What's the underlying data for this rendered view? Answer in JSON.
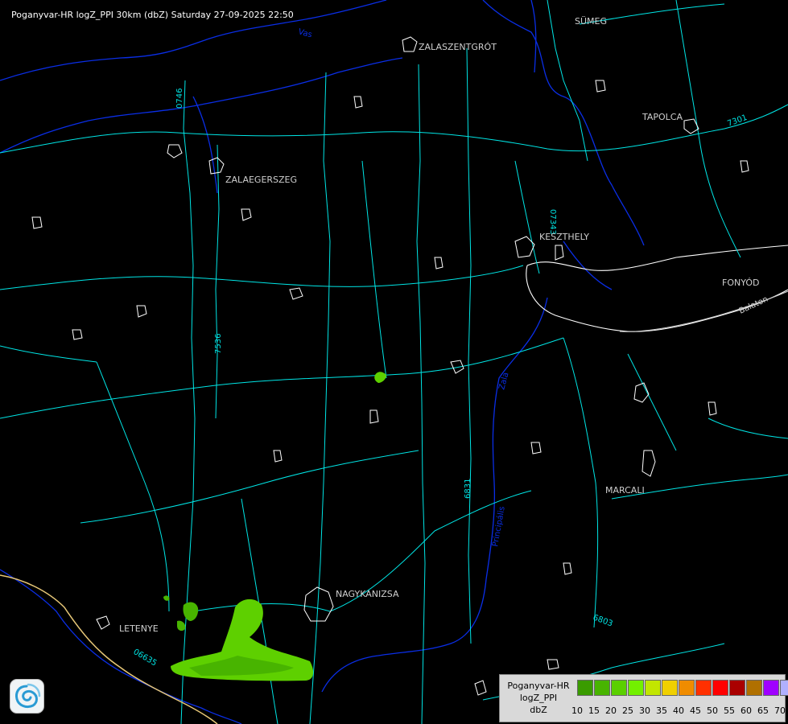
{
  "title": "Poganyvar-HR logZ_PPI 30km (dbZ) Saturday 27-09-2025 22:50",
  "cities": [
    {
      "name": "SÜMEG",
      "id": "sumeg"
    },
    {
      "name": "ZALASZENTGRÓT",
      "id": "zalaszentgrot"
    },
    {
      "name": "TAPOLCA",
      "id": "tapolca"
    },
    {
      "name": "ZALAEGERSZEG",
      "id": "zalaegerszeg"
    },
    {
      "name": "KESZTHELY",
      "id": "keszthely"
    },
    {
      "name": "FONYÓD",
      "id": "fonyod"
    },
    {
      "name": "MARCALI",
      "id": "marcali"
    },
    {
      "name": "NAGYKANIZSA",
      "id": "nagykanizsa"
    },
    {
      "name": "LETENYE",
      "id": "letenye"
    }
  ],
  "road_labels": [
    "0746",
    "07343",
    "7301",
    "7536",
    "6831",
    "6803",
    "06635"
  ],
  "river_labels": [
    "Vas",
    "Zala",
    "Principális",
    "Balaton"
  ],
  "legend": {
    "line1": "Poganyvar-HR",
    "line2": "logZ_PPI",
    "line3": "dbZ",
    "levels": [
      10,
      15,
      20,
      25,
      30,
      35,
      40,
      45,
      50,
      55,
      60,
      65,
      70
    ],
    "colors": [
      "#3a9b00",
      "#48b400",
      "#5bd000",
      "#73f000",
      "#c2e600",
      "#f0d000",
      "#f08c00",
      "#ff3000",
      "#ff0000",
      "#aa0000",
      "#b07000",
      "#a000ff",
      "#b0b0ff"
    ]
  },
  "colors": {
    "background": "#000000",
    "roads": "#00e5e5",
    "rivers": "#0a2ee6",
    "settlements": "#ffffff",
    "border": "#e8c878",
    "echo_light": "#5ed000",
    "echo_mid": "#48b400"
  },
  "logo_icon": "omsz-logo-icon"
}
